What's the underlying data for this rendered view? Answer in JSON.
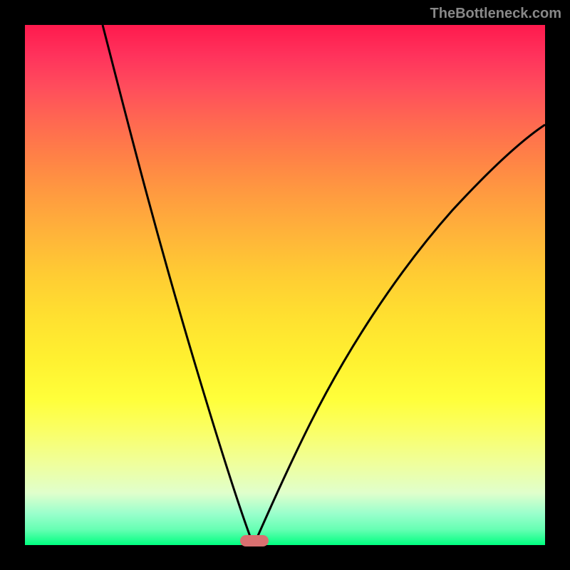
{
  "watermark": "TheBottleneck.com",
  "chart_data": {
    "type": "line",
    "title": "",
    "xlabel": "",
    "ylabel": "",
    "xlim": [
      0,
      100
    ],
    "ylim": [
      0,
      100
    ],
    "grid": false,
    "series": [
      {
        "name": "left-curve",
        "x": [
          15,
          18,
          21,
          24,
          27,
          30,
          33,
          35,
          37,
          39,
          41,
          42,
          43,
          44
        ],
        "y": [
          100,
          88,
          76,
          64,
          53,
          42,
          32,
          25,
          18,
          12,
          7,
          4,
          2,
          0
        ]
      },
      {
        "name": "right-curve",
        "x": [
          44,
          46,
          49,
          53,
          58,
          64,
          71,
          79,
          88,
          100
        ],
        "y": [
          0,
          3,
          8,
          15,
          24,
          34,
          45,
          56,
          67,
          80
        ]
      }
    ],
    "marker": {
      "x": 44,
      "y": 0,
      "color": "#d97070"
    },
    "gradient_stops": [
      {
        "pos": 0,
        "color": "#ff1a4d"
      },
      {
        "pos": 50,
        "color": "#ffcc33"
      },
      {
        "pos": 100,
        "color": "#00ff80"
      }
    ]
  }
}
